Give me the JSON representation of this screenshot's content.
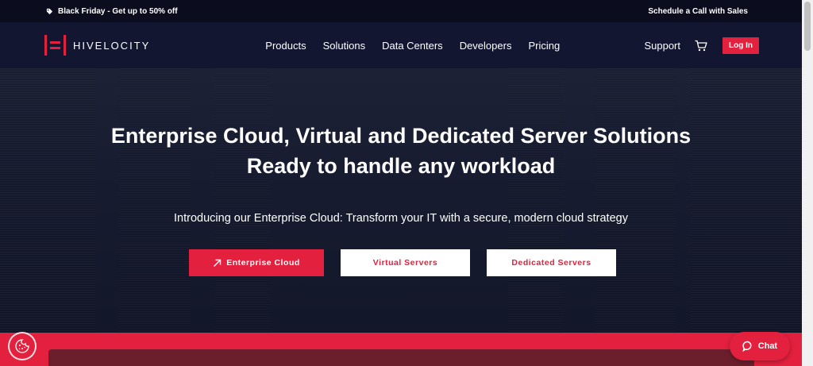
{
  "promo": {
    "text": "Black Friday - Get up to 50% off",
    "icon": "tag-icon",
    "sales_link": "Schedule a Call with Sales"
  },
  "nav": {
    "logo_text": "HIVELOCITY",
    "links": [
      "Products",
      "Solutions",
      "Data Centers",
      "Developers",
      "Pricing"
    ],
    "support": "Support",
    "login": "Log In"
  },
  "hero": {
    "title_line1": "Enterprise Cloud, Virtual and Dedicated Server Solutions",
    "title_line2": "Ready to handle any workload",
    "subtitle": "Introducing our Enterprise Cloud: Transform your IT with a secure, modern cloud strategy",
    "buttons": {
      "primary": "Enterprise Cloud",
      "virtual": "Virtual Servers",
      "dedicated": "Dedicated Servers"
    }
  },
  "chat": {
    "label": "Chat"
  },
  "colors": {
    "brand_red": "#e3203d",
    "navy": "#121631",
    "dark": "#0b0d1f"
  }
}
